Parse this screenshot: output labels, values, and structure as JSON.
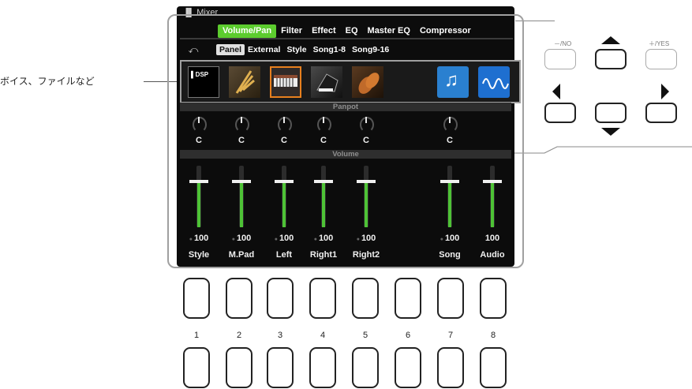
{
  "screen": {
    "app_title": "Mixer",
    "tabs": [
      "Volume/Pan",
      "Filter",
      "Effect",
      "EQ",
      "Master EQ",
      "Compressor"
    ],
    "active_tab": "Volume/Pan",
    "subtabs": [
      "Panel",
      "External",
      "Style",
      "Song1-8",
      "Song9-16"
    ],
    "active_subtab": "Panel",
    "panpot_header": "Panpot",
    "volume_header": "Volume",
    "icons": [
      "dsp-icon",
      "saxophone-icon",
      "keyboard-icon",
      "piano-icon",
      "strings-icon",
      "empty",
      "song-note-icon",
      "audio-wave-icon"
    ],
    "pan": [
      "C",
      "C",
      "C",
      "C",
      "C",
      "",
      "C",
      ""
    ],
    "volumes": [
      "100",
      "100",
      "100",
      "100",
      "100",
      "",
      "100",
      "100"
    ],
    "channels": [
      "Style",
      "M.Pad",
      "Left",
      "Right1",
      "Right2",
      "",
      "Song",
      "Audio"
    ]
  },
  "callout": {
    "text": "ボイス、ファイルなど"
  },
  "hardware": {
    "no_label": "－/NO",
    "yes_label": "＋/YES",
    "numbers": [
      "1",
      "2",
      "3",
      "4",
      "5",
      "6",
      "7",
      "8"
    ]
  },
  "colors": {
    "tab_active": "#5ccc2e",
    "fader_fill": "#4ec336",
    "selection": "#e8801e"
  }
}
